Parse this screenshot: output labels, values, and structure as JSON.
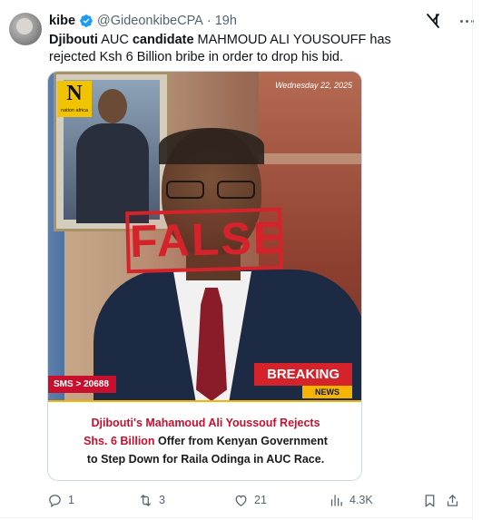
{
  "author": {
    "name": "kibe",
    "handle": "@GideonkibeCPA",
    "separator": "·",
    "time": "19h"
  },
  "tweet": {
    "text_parts": [
      {
        "text": "Djibouti",
        "bold": true
      },
      {
        "text": " AUC ",
        "bold": false
      },
      {
        "text": "candidate",
        "bold": true
      },
      {
        "text": " MAHMOUD ALI YOUSOUFF has rejected Ksh 6 Billion bribe in order to drop his bid.",
        "bold": false
      }
    ]
  },
  "media": {
    "logo_letter": "N",
    "logo_text": "nation africa",
    "date": "Wednesday 22, 2025",
    "stamp": "FALSE",
    "sms": "SMS > 20688",
    "breaking": "BREAKING",
    "news": "NEWS",
    "caption_line1": "Djibouti's Mahamoud Ali Youssouf Rejects",
    "caption_line2_red": "Shs. 6 Billion",
    "caption_line2_rest": " Offer from Kenyan Government",
    "caption_line3": "to Step Down for Raila Odinga in AUC Race."
  },
  "actions": {
    "replies": "1",
    "retweets": "3",
    "likes": "21",
    "views": "4.3K"
  },
  "colors": {
    "accent": "#1d9bf0",
    "muted": "#536471",
    "stamp_red": "#d4232a",
    "news_yellow": "#f5b400"
  },
  "icons": [
    "verified-badge-icon",
    "grok-icon",
    "more-icon",
    "reply-icon",
    "retweet-icon",
    "like-icon",
    "views-icon",
    "bookmark-icon",
    "share-icon"
  ]
}
